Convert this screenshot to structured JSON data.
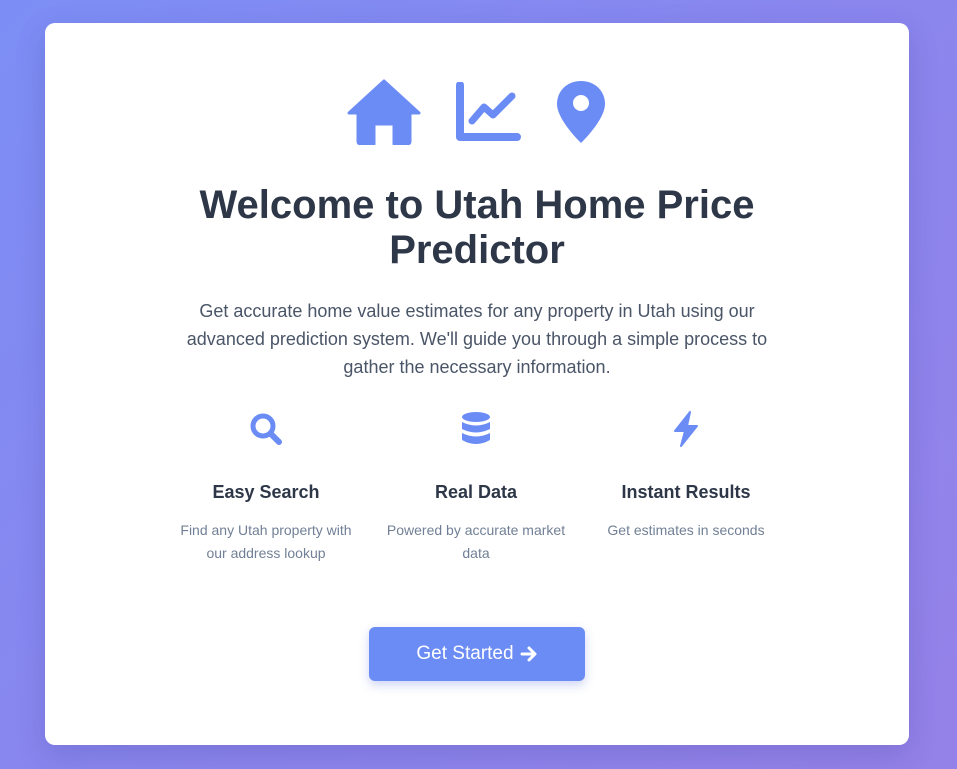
{
  "theme": {
    "accent": "#6b8cf5",
    "text_dark": "#2d3748",
    "text_muted": "#718096"
  },
  "hero": {
    "icons": [
      "home-icon",
      "chart-line-icon",
      "map-pin-icon"
    ],
    "title": "Welcome to Utah Home Price Predictor",
    "subtitle": "Get accurate home value estimates for any property in Utah using our advanced prediction system. We'll guide you through a simple process to gather the necessary information."
  },
  "features": [
    {
      "icon": "search-icon",
      "title": "Easy Search",
      "description": "Find any Utah property with our address lookup"
    },
    {
      "icon": "database-icon",
      "title": "Real Data",
      "description": "Powered by accurate market data"
    },
    {
      "icon": "bolt-icon",
      "title": "Instant Results",
      "description": "Get estimates in seconds"
    }
  ],
  "cta": {
    "label": "Get Started",
    "icon": "arrow-right-icon"
  }
}
